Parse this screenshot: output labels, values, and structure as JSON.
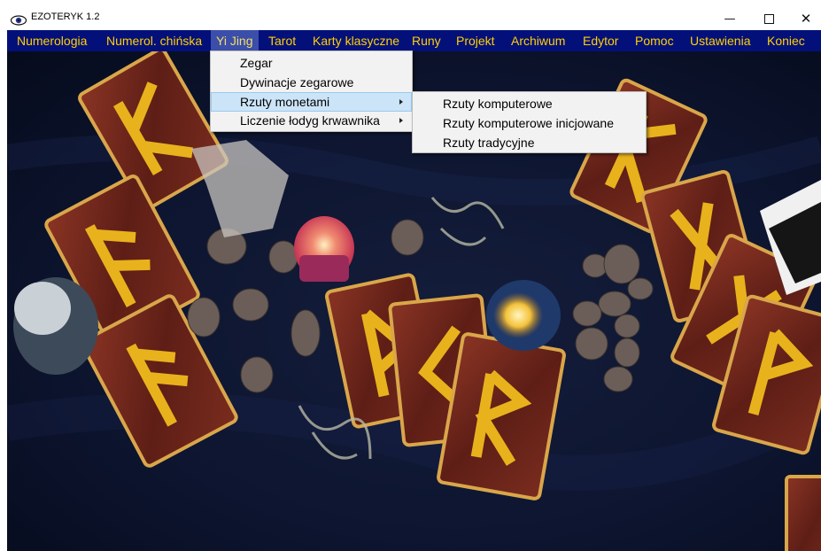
{
  "window": {
    "title": "EZOTERYK 1.2",
    "icon": "eye-icon",
    "controls": {
      "minimize": "—",
      "close": "✕"
    }
  },
  "menubar": {
    "items": [
      {
        "label": "Numerologia"
      },
      {
        "label": "Numerol. chińska"
      },
      {
        "label": "Yi Jing",
        "active": true
      },
      {
        "label": "Tarot"
      },
      {
        "label": "Karty klasyczne"
      },
      {
        "label": "Runy"
      },
      {
        "label": "Projekt"
      },
      {
        "label": "Archiwum"
      },
      {
        "label": "Edytor"
      },
      {
        "label": "Pomoc"
      },
      {
        "label": "Ustawienia"
      },
      {
        "label": "Koniec"
      }
    ]
  },
  "yijing_menu": {
    "items": [
      {
        "label": "Zegar"
      },
      {
        "label": "Dywinacje zegarowe"
      },
      {
        "label": "Rzuty monetami",
        "submenu": true,
        "highlighted": true
      },
      {
        "label": "Liczenie łodyg krwawnika",
        "submenu": true
      }
    ]
  },
  "rzuty_submenu": {
    "items": [
      {
        "label": "Rzuty komputerowe"
      },
      {
        "label": "Rzuty komputerowe inicjowane"
      },
      {
        "label": "Rzuty tradycyjne"
      }
    ]
  },
  "colors": {
    "menubar_bg": "#04107a",
    "menubar_text": "#ffd100",
    "menu_highlight": "#cce4f7",
    "card_red": "#7a2a1e",
    "rune_gold": "#e8b21c"
  }
}
